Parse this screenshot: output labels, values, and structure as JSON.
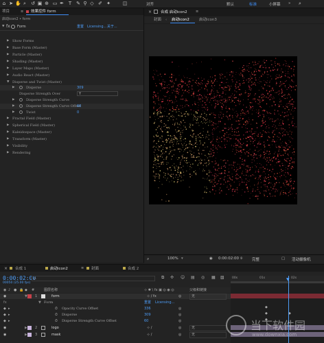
{
  "toolbar": {
    "align_label": "对齐",
    "workspaces": [
      "默认",
      "标准",
      "小屏幕"
    ],
    "active_workspace": "标准",
    "overflow": "»"
  },
  "effect_controls": {
    "tab_project": "项目",
    "tab_effect": "效果控件 form",
    "path": "启动icon2 • form",
    "effect_name": "Form",
    "reset": "重置",
    "licensing": "Licensing...",
    "about": "关于...",
    "groups": [
      "Show Forms",
      "Base Form (Master)",
      "Particle (Master)",
      "Shading (Master)",
      "Layer Maps (Master)",
      "Audio React (Master)"
    ],
    "disperse_group": "Disperse and Twist (Master)",
    "disperse": {
      "label": "Disperse",
      "value": "309"
    },
    "strength_over": {
      "label": "Disperse Strength Over",
      "value": "Y"
    },
    "strength_curve": {
      "label": "Disperse Strength Curve"
    },
    "curve_offset": {
      "label": "Disperse Strength Curve Offset",
      "value": "60"
    },
    "twist": {
      "label": "Twist",
      "value": "0"
    },
    "groups_after": [
      "Fractal Field (Master)",
      "Spherical Field (Master)",
      "Kaleidospace (Master)",
      "Transform (Master)",
      "Visibility",
      "Rendering"
    ]
  },
  "composition": {
    "tab_label": "合成 启动icon2",
    "breadcrumbs": [
      "封面",
      "启动icon2",
      "启动icon3"
    ],
    "zoom": "100%",
    "timecode": "0:00:02:00",
    "resolution": "完整",
    "camera": "活动摄像机"
  },
  "timeline": {
    "tabs": [
      "合成 1",
      "启动icon2",
      "封面",
      "合成 2"
    ],
    "active_tab": "启动icon2",
    "timecode": "0:00:02:00",
    "frame_info": "00050 (25.00 fps)",
    "search_placeholder": "ρ.",
    "col_source": "图层名称",
    "col_parent": "父级和链接",
    "ruler": [
      "00s",
      "01s",
      "02s"
    ],
    "layers": [
      {
        "num": "1",
        "name": "form",
        "parent": "无",
        "color": "#c8414b"
      },
      {
        "num": "2",
        "name": "logo",
        "parent": "无",
        "color": "#c8b4dc"
      },
      {
        "num": "3",
        "name": "mask",
        "parent": "无",
        "color": "#c8b4dc"
      }
    ],
    "form_effect": "Form",
    "form_reset": "重置",
    "form_licensing": "Licensing...",
    "props": [
      {
        "label": "Opacity Curve Offset",
        "value": "336"
      },
      {
        "label": "Disperse",
        "value": "309"
      },
      {
        "label": "Disperse Strength Curve Offset",
        "value": "60"
      }
    ]
  },
  "watermark": {
    "line1": "当下软件园",
    "line2": "www.downxia.com"
  }
}
